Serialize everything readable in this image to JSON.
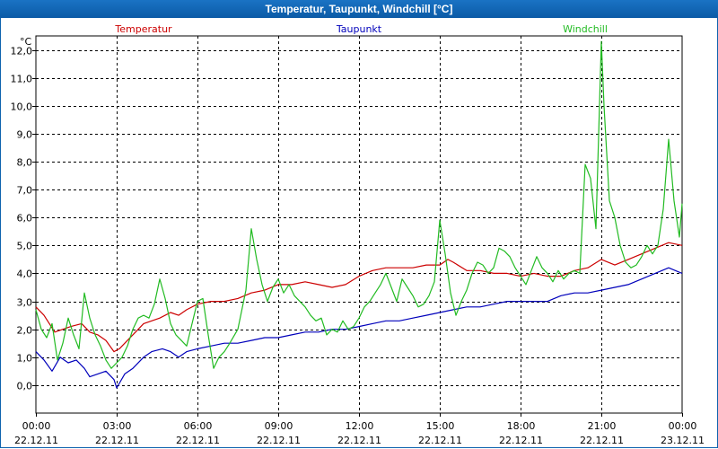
{
  "window": {
    "title": "Temperatur, Taupunkt, Windchill [°C]"
  },
  "chart_data": {
    "type": "line",
    "title": "Temperatur, Taupunkt, Windchill [°C]",
    "ylabel": "°C",
    "ylim": [
      -1.0,
      12.5
    ],
    "yticks": [
      {
        "v": 0,
        "label": "0,0"
      },
      {
        "v": 1,
        "label": "1,0"
      },
      {
        "v": 2,
        "label": "2,0"
      },
      {
        "v": 3,
        "label": "3,0"
      },
      {
        "v": 4,
        "label": "4,0"
      },
      {
        "v": 5,
        "label": "5,0"
      },
      {
        "v": 6,
        "label": "6,0"
      },
      {
        "v": 7,
        "label": "7,0"
      },
      {
        "v": 8,
        "label": "8,0"
      },
      {
        "v": 9,
        "label": "9,0"
      },
      {
        "v": 10,
        "label": "10,0"
      },
      {
        "v": 11,
        "label": "11,0"
      },
      {
        "v": 12,
        "label": "12,0"
      }
    ],
    "xlim_hours": [
      0,
      24
    ],
    "xticks": [
      {
        "h": 0,
        "time": "00:00",
        "date": "22.12.11"
      },
      {
        "h": 3,
        "time": "03:00",
        "date": "22.12.11"
      },
      {
        "h": 6,
        "time": "06:00",
        "date": "22.12.11"
      },
      {
        "h": 9,
        "time": "09:00",
        "date": "22.12.11"
      },
      {
        "h": 12,
        "time": "12:00",
        "date": "22.12.11"
      },
      {
        "h": 15,
        "time": "15:00",
        "date": "22.12.11"
      },
      {
        "h": 18,
        "time": "18:00",
        "date": "22.12.11"
      },
      {
        "h": 21,
        "time": "21:00",
        "date": "22.12.11"
      },
      {
        "h": 24,
        "time": "00:00",
        "date": "23.12.11"
      }
    ],
    "grid": true,
    "legend_position": "top",
    "series": [
      {
        "name": "Temperatur",
        "color": "#cc0000",
        "points": [
          [
            0,
            2.8
          ],
          [
            0.3,
            2.5
          ],
          [
            0.5,
            2.2
          ],
          [
            0.7,
            1.9
          ],
          [
            1.0,
            2.0
          ],
          [
            1.3,
            2.1
          ],
          [
            1.7,
            2.2
          ],
          [
            2.0,
            1.9
          ],
          [
            2.3,
            1.8
          ],
          [
            2.6,
            1.6
          ],
          [
            2.9,
            1.2
          ],
          [
            3.1,
            1.3
          ],
          [
            3.4,
            1.6
          ],
          [
            3.7,
            1.9
          ],
          [
            4.0,
            2.2
          ],
          [
            4.3,
            2.3
          ],
          [
            4.6,
            2.4
          ],
          [
            5.0,
            2.6
          ],
          [
            5.3,
            2.5
          ],
          [
            5.6,
            2.7
          ],
          [
            6.0,
            2.9
          ],
          [
            6.5,
            3.0
          ],
          [
            7.0,
            3.0
          ],
          [
            7.5,
            3.1
          ],
          [
            8.0,
            3.3
          ],
          [
            8.5,
            3.4
          ],
          [
            9.0,
            3.6
          ],
          [
            9.5,
            3.6
          ],
          [
            10.0,
            3.7
          ],
          [
            10.5,
            3.6
          ],
          [
            11.0,
            3.5
          ],
          [
            11.5,
            3.6
          ],
          [
            12.0,
            3.9
          ],
          [
            12.5,
            4.1
          ],
          [
            13.0,
            4.2
          ],
          [
            13.5,
            4.2
          ],
          [
            14.0,
            4.2
          ],
          [
            14.5,
            4.3
          ],
          [
            15.0,
            4.3
          ],
          [
            15.3,
            4.5
          ],
          [
            15.5,
            4.4
          ],
          [
            16.0,
            4.1
          ],
          [
            16.5,
            4.1
          ],
          [
            17.0,
            4.0
          ],
          [
            17.5,
            4.0
          ],
          [
            18.0,
            3.9
          ],
          [
            18.5,
            4.0
          ],
          [
            19.0,
            3.9
          ],
          [
            19.5,
            3.9
          ],
          [
            20.0,
            4.1
          ],
          [
            20.5,
            4.2
          ],
          [
            21.0,
            4.5
          ],
          [
            21.5,
            4.3
          ],
          [
            22.0,
            4.5
          ],
          [
            22.5,
            4.7
          ],
          [
            23.0,
            4.9
          ],
          [
            23.5,
            5.1
          ],
          [
            24.0,
            5.0
          ]
        ]
      },
      {
        "name": "Taupunkt",
        "color": "#0000bb",
        "points": [
          [
            0,
            1.2
          ],
          [
            0.3,
            0.9
          ],
          [
            0.6,
            0.5
          ],
          [
            0.9,
            1.0
          ],
          [
            1.2,
            0.8
          ],
          [
            1.5,
            0.9
          ],
          [
            1.8,
            0.6
          ],
          [
            2.0,
            0.3
          ],
          [
            2.3,
            0.4
          ],
          [
            2.6,
            0.5
          ],
          [
            2.9,
            0.2
          ],
          [
            3.0,
            -0.1
          ],
          [
            3.3,
            0.4
          ],
          [
            3.6,
            0.6
          ],
          [
            4.0,
            1.0
          ],
          [
            4.3,
            1.2
          ],
          [
            4.7,
            1.3
          ],
          [
            5.0,
            1.2
          ],
          [
            5.3,
            1.0
          ],
          [
            5.6,
            1.2
          ],
          [
            6.0,
            1.3
          ],
          [
            6.5,
            1.4
          ],
          [
            7.0,
            1.5
          ],
          [
            7.5,
            1.5
          ],
          [
            8.0,
            1.6
          ],
          [
            8.5,
            1.7
          ],
          [
            9.0,
            1.7
          ],
          [
            9.5,
            1.8
          ],
          [
            10.0,
            1.9
          ],
          [
            10.5,
            1.9
          ],
          [
            11.0,
            2.0
          ],
          [
            11.5,
            2.0
          ],
          [
            12.0,
            2.1
          ],
          [
            12.5,
            2.2
          ],
          [
            13.0,
            2.3
          ],
          [
            13.5,
            2.3
          ],
          [
            14.0,
            2.4
          ],
          [
            14.5,
            2.5
          ],
          [
            15.0,
            2.6
          ],
          [
            15.5,
            2.7
          ],
          [
            16.0,
            2.8
          ],
          [
            16.5,
            2.8
          ],
          [
            17.0,
            2.9
          ],
          [
            17.5,
            3.0
          ],
          [
            18.0,
            3.0
          ],
          [
            18.5,
            3.0
          ],
          [
            19.0,
            3.0
          ],
          [
            19.5,
            3.2
          ],
          [
            20.0,
            3.3
          ],
          [
            20.5,
            3.3
          ],
          [
            21.0,
            3.4
          ],
          [
            21.5,
            3.5
          ],
          [
            22.0,
            3.6
          ],
          [
            22.5,
            3.8
          ],
          [
            23.0,
            4.0
          ],
          [
            23.5,
            4.2
          ],
          [
            24.0,
            4.0
          ]
        ]
      },
      {
        "name": "Windchill",
        "color": "#22bb22",
        "points": [
          [
            0,
            2.7
          ],
          [
            0.2,
            2.0
          ],
          [
            0.4,
            1.7
          ],
          [
            0.6,
            2.2
          ],
          [
            0.8,
            0.9
          ],
          [
            1.0,
            1.5
          ],
          [
            1.2,
            2.4
          ],
          [
            1.4,
            1.8
          ],
          [
            1.6,
            1.3
          ],
          [
            1.8,
            3.3
          ],
          [
            2.0,
            2.4
          ],
          [
            2.2,
            1.8
          ],
          [
            2.4,
            1.4
          ],
          [
            2.6,
            0.9
          ],
          [
            2.8,
            0.6
          ],
          [
            3.0,
            0.8
          ],
          [
            3.2,
            1.0
          ],
          [
            3.4,
            1.4
          ],
          [
            3.6,
            2.0
          ],
          [
            3.8,
            2.4
          ],
          [
            4.0,
            2.5
          ],
          [
            4.2,
            2.4
          ],
          [
            4.4,
            2.9
          ],
          [
            4.6,
            3.8
          ],
          [
            4.8,
            3.1
          ],
          [
            5.0,
            2.2
          ],
          [
            5.2,
            1.8
          ],
          [
            5.4,
            1.6
          ],
          [
            5.6,
            1.4
          ],
          [
            5.8,
            2.2
          ],
          [
            6.0,
            3.0
          ],
          [
            6.2,
            3.1
          ],
          [
            6.4,
            1.8
          ],
          [
            6.6,
            0.6
          ],
          [
            6.8,
            1.0
          ],
          [
            7.0,
            1.2
          ],
          [
            7.2,
            1.5
          ],
          [
            7.5,
            2.0
          ],
          [
            7.8,
            3.4
          ],
          [
            8.0,
            5.6
          ],
          [
            8.2,
            4.5
          ],
          [
            8.4,
            3.6
          ],
          [
            8.6,
            3.0
          ],
          [
            8.8,
            3.5
          ],
          [
            9.0,
            3.8
          ],
          [
            9.2,
            3.3
          ],
          [
            9.4,
            3.6
          ],
          [
            9.6,
            3.2
          ],
          [
            9.8,
            3.0
          ],
          [
            10.0,
            2.8
          ],
          [
            10.2,
            2.5
          ],
          [
            10.4,
            2.3
          ],
          [
            10.6,
            2.4
          ],
          [
            10.8,
            1.8
          ],
          [
            11.0,
            2.0
          ],
          [
            11.2,
            1.9
          ],
          [
            11.4,
            2.3
          ],
          [
            11.6,
            2.0
          ],
          [
            11.8,
            2.1
          ],
          [
            12.0,
            2.4
          ],
          [
            12.2,
            2.8
          ],
          [
            12.4,
            3.0
          ],
          [
            12.6,
            3.3
          ],
          [
            12.8,
            3.6
          ],
          [
            13.0,
            4.0
          ],
          [
            13.2,
            3.5
          ],
          [
            13.4,
            3.0
          ],
          [
            13.6,
            3.8
          ],
          [
            13.8,
            3.5
          ],
          [
            14.0,
            3.2
          ],
          [
            14.2,
            2.8
          ],
          [
            14.4,
            2.9
          ],
          [
            14.6,
            3.2
          ],
          [
            14.8,
            3.7
          ],
          [
            15.0,
            5.9
          ],
          [
            15.2,
            4.7
          ],
          [
            15.4,
            3.3
          ],
          [
            15.6,
            2.5
          ],
          [
            15.8,
            3.0
          ],
          [
            16.0,
            3.4
          ],
          [
            16.2,
            4.0
          ],
          [
            16.4,
            4.4
          ],
          [
            16.6,
            4.3
          ],
          [
            16.8,
            4.0
          ],
          [
            17.0,
            4.2
          ],
          [
            17.2,
            4.9
          ],
          [
            17.4,
            4.8
          ],
          [
            17.6,
            4.6
          ],
          [
            17.8,
            4.2
          ],
          [
            18.0,
            3.9
          ],
          [
            18.2,
            3.6
          ],
          [
            18.4,
            4.1
          ],
          [
            18.6,
            4.6
          ],
          [
            18.8,
            4.2
          ],
          [
            19.0,
            4.0
          ],
          [
            19.2,
            3.7
          ],
          [
            19.4,
            4.1
          ],
          [
            19.6,
            3.8
          ],
          [
            19.8,
            4.0
          ],
          [
            20.0,
            4.1
          ],
          [
            20.2,
            4.0
          ],
          [
            20.4,
            7.9
          ],
          [
            20.6,
            7.4
          ],
          [
            20.8,
            5.6
          ],
          [
            21.0,
            12.3
          ],
          [
            21.1,
            10.0
          ],
          [
            21.3,
            6.6
          ],
          [
            21.5,
            6.0
          ],
          [
            21.7,
            5.0
          ],
          [
            21.9,
            4.4
          ],
          [
            22.1,
            4.2
          ],
          [
            22.3,
            4.3
          ],
          [
            22.5,
            4.6
          ],
          [
            22.7,
            5.0
          ],
          [
            22.9,
            4.7
          ],
          [
            23.1,
            5.0
          ],
          [
            23.3,
            6.3
          ],
          [
            23.5,
            8.8
          ],
          [
            23.7,
            6.6
          ],
          [
            23.9,
            5.3
          ],
          [
            24.0,
            6.5
          ]
        ]
      }
    ]
  }
}
